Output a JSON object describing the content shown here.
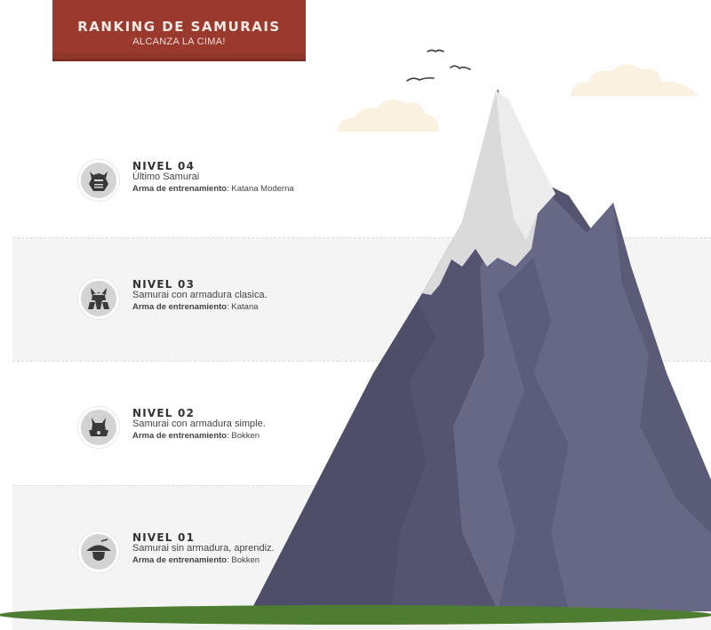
{
  "header": {
    "title": "Ranking de Samurais",
    "subtitle": "ALCANZA LA CIMA!"
  },
  "levels": [
    {
      "title": "NIVEL 04",
      "description": "Último Samurai",
      "weapon_label": "Arma de entrenamiento",
      "weapon_value": ": Katana Moderna",
      "icon": "samurai-mask-icon"
    },
    {
      "title": "NIVEL 03",
      "description": "Samurai con armadura clasica.",
      "weapon_label": "Arma de entrenamiento",
      "weapon_value": ": Katana",
      "icon": "samurai-helmet-classic-icon"
    },
    {
      "title": "NIVEL 02",
      "description": "Samurai con armadura simple.",
      "weapon_label": "Arma de entrenamiento",
      "weapon_value": ": Bokken",
      "icon": "samurai-helmet-simple-icon"
    },
    {
      "title": "NIVEL 01",
      "description": "Samurai sin armadura, aprendiz.",
      "weapon_label": "Arma de entrenamiento",
      "weapon_value": ": Bokken",
      "icon": "straw-hat-apprentice-icon"
    }
  ],
  "colors": {
    "banner": "#9a3a2e",
    "mountain_dark": "#545470",
    "mountain_light": "#666784",
    "snow": "#e4e4e4",
    "grass": "#4e7d32",
    "cloud": "#fbf3e6"
  }
}
